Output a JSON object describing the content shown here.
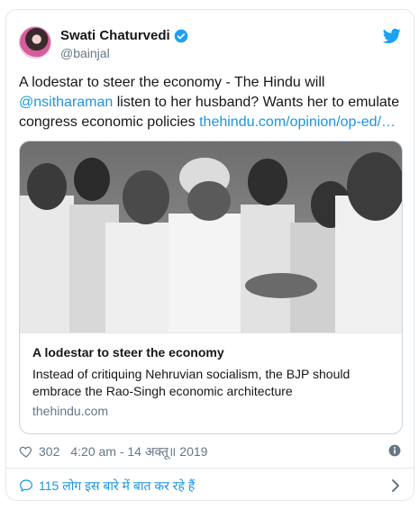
{
  "author": {
    "name": "Swati Chaturvedi",
    "handle": "@bainjal"
  },
  "tweet": {
    "text_before": "A lodestar to steer the economy - The Hindu will ",
    "mention": "@nsitharaman",
    "text_after": " listen to her husband? Wants her to emulate congress economic policies ",
    "link": "thehindu.com/opinion/op-ed/…"
  },
  "card": {
    "title": "A lodestar to steer the economy",
    "description": "Instead of critiquing Nehruvian socialism, the BJP should embrace the Rao-Singh economic architecture",
    "domain": "thehindu.com"
  },
  "meta": {
    "likes": "302",
    "timestamp": "4:20 am - 14 अक्तू॥ 2019"
  },
  "replies": {
    "label": "115 लोग इस बारे में बात कर रहे हैं"
  },
  "icons": {
    "verified": "verified-badge-icon",
    "brand": "twitter-bird-icon",
    "like": "heart-icon",
    "info": "info-icon",
    "reply": "speech-bubble-icon",
    "more": "chevron-right-icon"
  },
  "colors": {
    "link": "#1b95e0",
    "muted": "#657786",
    "border": "#e1e8ed"
  }
}
